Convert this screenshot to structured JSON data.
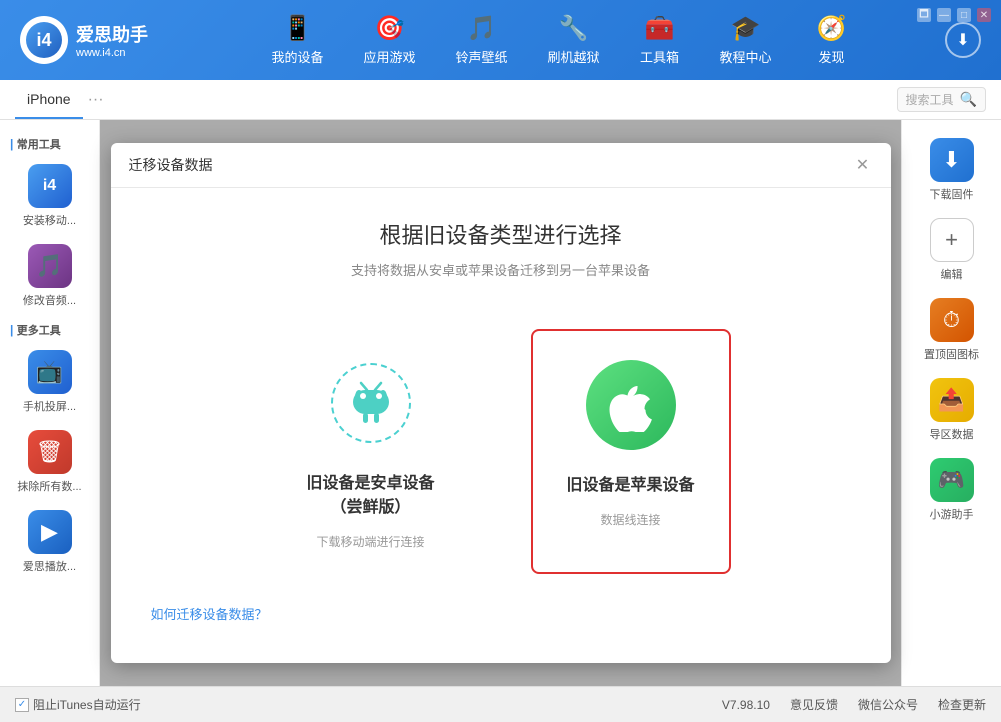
{
  "app": {
    "logo_main": "i4",
    "logo_url": "www.i4.cn",
    "logo_brand": "爱思助手"
  },
  "nav": {
    "items": [
      {
        "id": "my-device",
        "label": "我的设备",
        "icon": "📱"
      },
      {
        "id": "apps",
        "label": "应用游戏",
        "icon": "🎯"
      },
      {
        "id": "ringtones",
        "label": "铃声壁纸",
        "icon": "🎵"
      },
      {
        "id": "jailbreak",
        "label": "刷机越狱",
        "icon": "🔧"
      },
      {
        "id": "toolbox",
        "label": "工具箱",
        "icon": "🧰"
      },
      {
        "id": "tutorial",
        "label": "教程中心",
        "icon": "🎓"
      },
      {
        "id": "discover",
        "label": "发现",
        "icon": "🧭"
      }
    ],
    "download_btn": "⬇"
  },
  "win_controls": [
    "🗖",
    "—",
    "□",
    "✕"
  ],
  "sub_header": {
    "device_tab": "iPhone",
    "more_icon": "•••",
    "search_placeholder": "搜索工具"
  },
  "sidebar": {
    "common_tools_label": "▌常用工具",
    "more_tools_label": "▌更多工具",
    "common_items": [
      {
        "id": "install-app",
        "label": "安装移动...",
        "color": "#3a8de8",
        "icon": "i4"
      },
      {
        "id": "modify-audio",
        "label": "修改音频...",
        "color": "#8e44ad",
        "icon": "🎵"
      }
    ],
    "more_items": [
      {
        "id": "screen-mirror",
        "label": "手机投屏...",
        "color": "#3a8de8",
        "icon": "📺"
      },
      {
        "id": "erase-data",
        "label": "抹除所有数...",
        "color": "#e74c3c",
        "icon": "🗑"
      },
      {
        "id": "play-app",
        "label": "爱思播放...",
        "color": "#3a8de8",
        "icon": "▶"
      }
    ]
  },
  "right_sidebar": {
    "items": [
      {
        "id": "download-firmware",
        "label": "下载固件",
        "color": "#3a8de8",
        "icon": "⬇"
      },
      {
        "id": "edit",
        "label": "编辑",
        "color": "#27ae60",
        "icon": "+"
      },
      {
        "id": "clock-icon",
        "label": "置顶固图标",
        "color": "#e67e22",
        "icon": "⏱"
      },
      {
        "id": "export-data",
        "label": "导区数据",
        "color": "#f1c40f",
        "icon": "📤"
      },
      {
        "id": "mini-game",
        "label": "小游助手",
        "color": "#2ecc71",
        "icon": "🎮"
      }
    ]
  },
  "modal": {
    "title": "迁移设备数据",
    "close_icon": "✕",
    "heading": "根据旧设备类型进行选择",
    "subtitle": "支持将数据从安卓或苹果设备迁移到另一台苹果设备",
    "options": [
      {
        "id": "android-option",
        "title": "旧设备是安卓设备（尝鲜版）",
        "desc": "下载移动端进行连接",
        "selected": false
      },
      {
        "id": "apple-option",
        "title": "旧设备是苹果设备",
        "desc": "数据线连接",
        "selected": true
      }
    ],
    "footer_link": "如何迁移设备数据？"
  },
  "bottom_bar": {
    "checkbox_label": "阻止iTunes自动运行",
    "version": "V7.98.10",
    "feedback": "意见反馈",
    "wechat": "微信公众号",
    "check_update": "检查更新"
  }
}
